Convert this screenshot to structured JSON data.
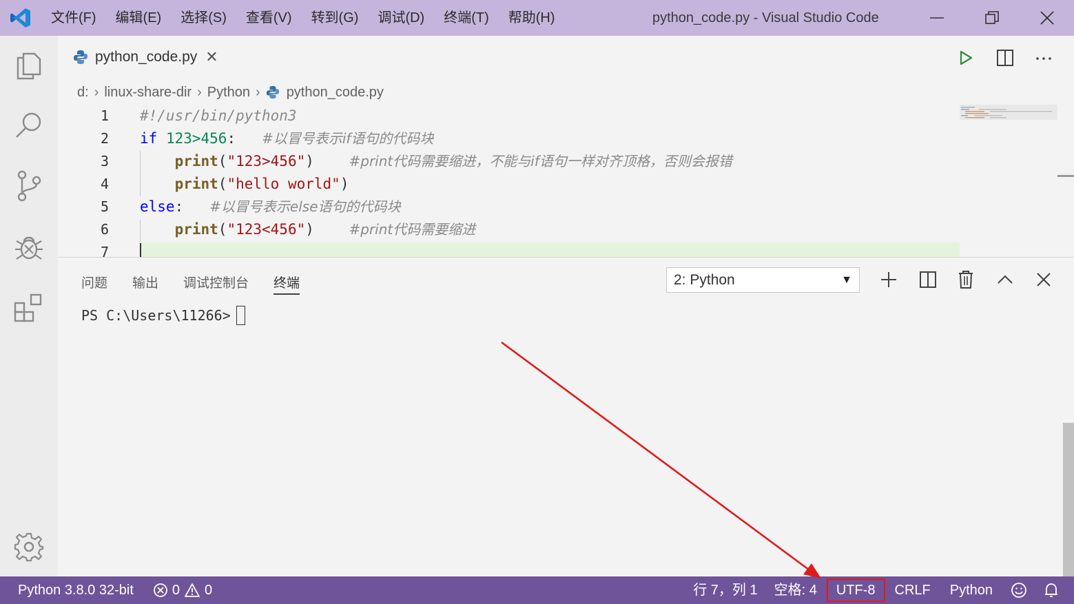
{
  "window": {
    "title": "python_code.py - Visual Studio Code",
    "menu": [
      "文件(F)",
      "编辑(E)",
      "选择(S)",
      "查看(V)",
      "转到(G)",
      "调试(D)",
      "终端(T)",
      "帮助(H)"
    ]
  },
  "activity_bar": {
    "icons": [
      "explorer-icon",
      "search-icon",
      "source-control-icon",
      "debug-icon",
      "extensions-icon",
      "settings-gear-icon"
    ]
  },
  "editor": {
    "tab_label": "python_code.py",
    "breadcrumb": [
      "d:",
      "linux-share-dir",
      "Python",
      "python_code.py"
    ],
    "lines": [
      {
        "n": "1",
        "code": "#!/usr/bin/python3"
      },
      {
        "n": "2",
        "kw": "if",
        "expr": "123>456",
        "punct": ":",
        "comment": "#以冒号表示if语句的代码块"
      },
      {
        "n": "3",
        "fn": "print",
        "open": "(",
        "str": "\"123>456\"",
        "close": ")",
        "comment": "#print代码需要缩进，不能与if语句一样对齐顶格，否则会报错"
      },
      {
        "n": "4",
        "fn": "print",
        "open": "(",
        "str": "\"hello world\"",
        "close": ")"
      },
      {
        "n": "5",
        "kw": "else",
        "punct": ":",
        "comment": "#以冒号表示else语句的代码块"
      },
      {
        "n": "6",
        "fn": "print",
        "open": "(",
        "str": "\"123<456\"",
        "close": ")",
        "comment": "#print代码需要缩进"
      },
      {
        "n": "7"
      }
    ]
  },
  "panel": {
    "tabs": [
      "问题",
      "输出",
      "调试控制台",
      "终端"
    ],
    "active_tab": "终端",
    "terminal_selected": "2: Python",
    "terminal_prompt": "PS C:\\Users\\11266>"
  },
  "status_bar": {
    "interpreter": "Python 3.8.0 32-bit",
    "errors": "0",
    "warnings": "0",
    "position": "行 7，列 1",
    "indent": "空格: 4",
    "encoding": "UTF-8",
    "eol": "CRLF",
    "language": "Python"
  },
  "colors": {
    "titlebar": "#c5b4dc",
    "statusbar": "#6f549a",
    "annotation": "#e01b1b"
  }
}
